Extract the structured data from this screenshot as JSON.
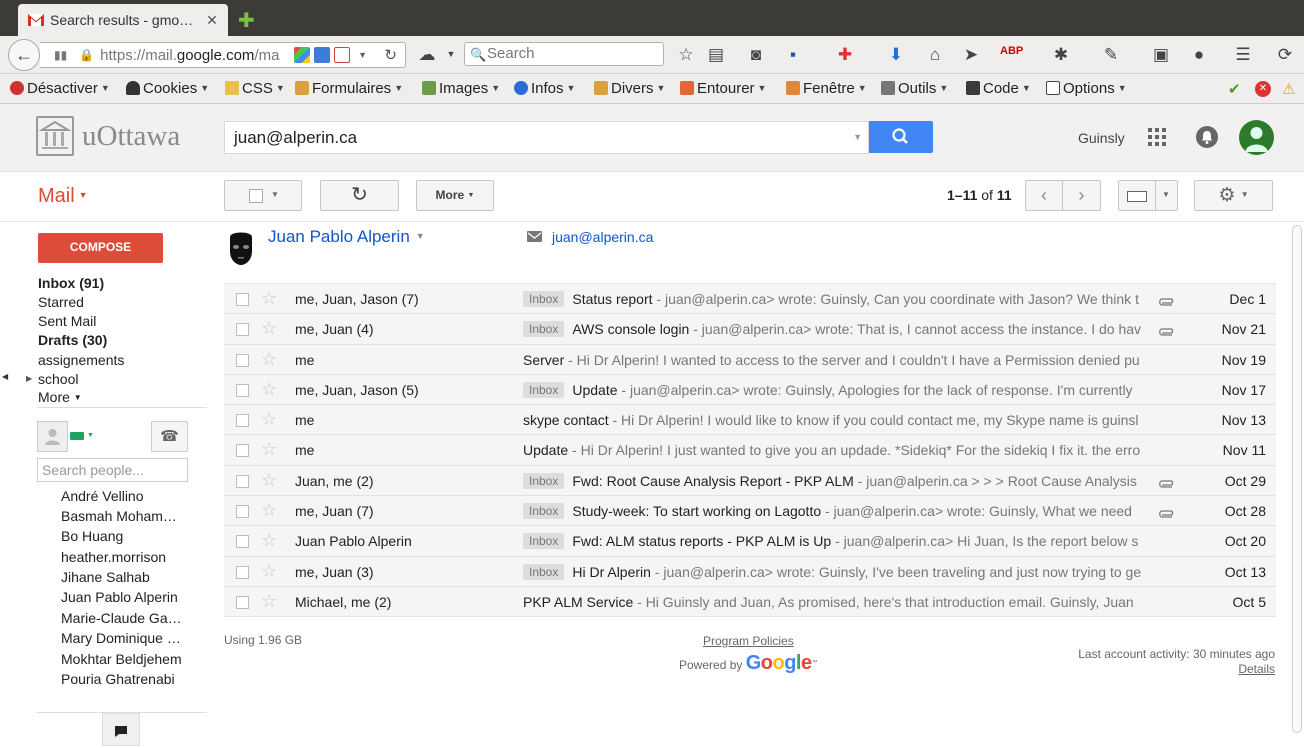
{
  "browser": {
    "tab_title": "Search results - gmo…",
    "url_prefix": "https://mail.",
    "url_domain": "google.com",
    "url_rest": "/ma",
    "search_placeholder": "Search"
  },
  "webdev_toolbar": {
    "items": [
      "Désactiver",
      "Cookies",
      "CSS",
      "Formulaires",
      "Images",
      "Infos",
      "Divers",
      "Entourer",
      "Fenêtre",
      "Outils",
      "Code",
      "Options"
    ]
  },
  "header": {
    "logo_text": "uOttawa",
    "search_value": "juan@alperin.ca",
    "account_name": "Guinsly"
  },
  "toolbar": {
    "mail_label": "Mail",
    "more_label": "More",
    "pager_range": "1–11",
    "pager_of": " of ",
    "pager_total": "11"
  },
  "sidebar": {
    "compose_label": "COMPOSE",
    "nav": [
      "Inbox (91)",
      "Starred",
      "Sent Mail",
      "Drafts (30)",
      "assignements",
      "school",
      "More"
    ],
    "people_search_placeholder": "Search people...",
    "contacts": [
      "André Vellino",
      "Basmah Moham…",
      "Bo Huang",
      "heather.morrison",
      "Jihane Salhab",
      "Juan Pablo Alperin",
      "Marie-Claude Ga…",
      "Mary Dominique …",
      "Mokhtar Beldjehem",
      "Pouria Ghatrenabi"
    ]
  },
  "person": {
    "name": "Juan Pablo Alperin",
    "email": "juan@alperin.ca"
  },
  "emails": [
    {
      "sender": "me, Juan, Jason (7)",
      "label": "Inbox",
      "subject": "Status report",
      "snippet": " - juan@alperin.ca> wrote: Guinsly, Can you coordinate with Jason? We think t",
      "attach": true,
      "date": "Dec 1"
    },
    {
      "sender": "me, Juan (4)",
      "label": "Inbox",
      "subject": "AWS console login",
      "snippet": " - juan@alperin.ca> wrote: That is, I cannot access the instance. I do hav",
      "attach": true,
      "date": "Nov 21"
    },
    {
      "sender": "me",
      "label": "",
      "subject": "Server",
      "snippet": " - Hi Dr Alperin! I wanted to access to the server and I couldn't I have a Permission denied pu",
      "attach": false,
      "date": "Nov 19"
    },
    {
      "sender": "me, Juan, Jason (5)",
      "label": "Inbox",
      "subject": "Update",
      "snippet": " - juan@alperin.ca> wrote: Guinsly, Apologies for the lack of response. I'm currently",
      "attach": false,
      "date": "Nov 17"
    },
    {
      "sender": "me",
      "label": "",
      "subject": "skype contact",
      "snippet": " - Hi Dr Alperin! I would like to know if you could contact me, my Skype name is guinsl",
      "attach": false,
      "date": "Nov 13"
    },
    {
      "sender": "me",
      "label": "",
      "subject": "Update",
      "snippet": " - Hi Dr Alperin! I just wanted to give you an updade. *Sidekiq* For the sidekiq I fix it. the erro",
      "attach": false,
      "date": "Nov 11"
    },
    {
      "sender": "Juan, me (2)",
      "label": "Inbox",
      "subject": "Fwd: Root Cause Analysis Report - PKP ALM",
      "snippet": " - juan@alperin.ca > > > Root Cause Analysis",
      "attach": true,
      "date": "Oct 29"
    },
    {
      "sender": "me, Juan (7)",
      "label": "Inbox",
      "subject": "Study-week: To start working on Lagotto",
      "snippet": " - juan@alperin.ca> wrote: Guinsly, What we need",
      "attach": true,
      "date": "Oct 28"
    },
    {
      "sender": "Juan Pablo Alperin",
      "label": "Inbox",
      "subject": "Fwd: ALM status reports - PKP ALM is Up",
      "snippet": " - juan@alperin.ca> Hi Juan, Is the report below s",
      "attach": false,
      "date": "Oct 20"
    },
    {
      "sender": "me, Juan (3)",
      "label": "Inbox",
      "subject": "Hi Dr Alperin",
      "snippet": " - juan@alperin.ca> wrote: Guinsly, I've been traveling and just now trying to ge",
      "attach": false,
      "date": "Oct 13"
    },
    {
      "sender": "Michael, me (2)",
      "label": "",
      "subject": "PKP ALM Service",
      "snippet": " - Hi Guinsly and Juan, As promised, here's that introduction email. Guinsly, Juan",
      "attach": false,
      "date": "Oct 5"
    }
  ],
  "footer": {
    "usage": "Using 1.96 GB",
    "policies": "Program Policies",
    "powered_by": "Powered by ",
    "google": "Google",
    "last_activity": "Last account activity: 30 minutes ago",
    "details": "Details"
  }
}
